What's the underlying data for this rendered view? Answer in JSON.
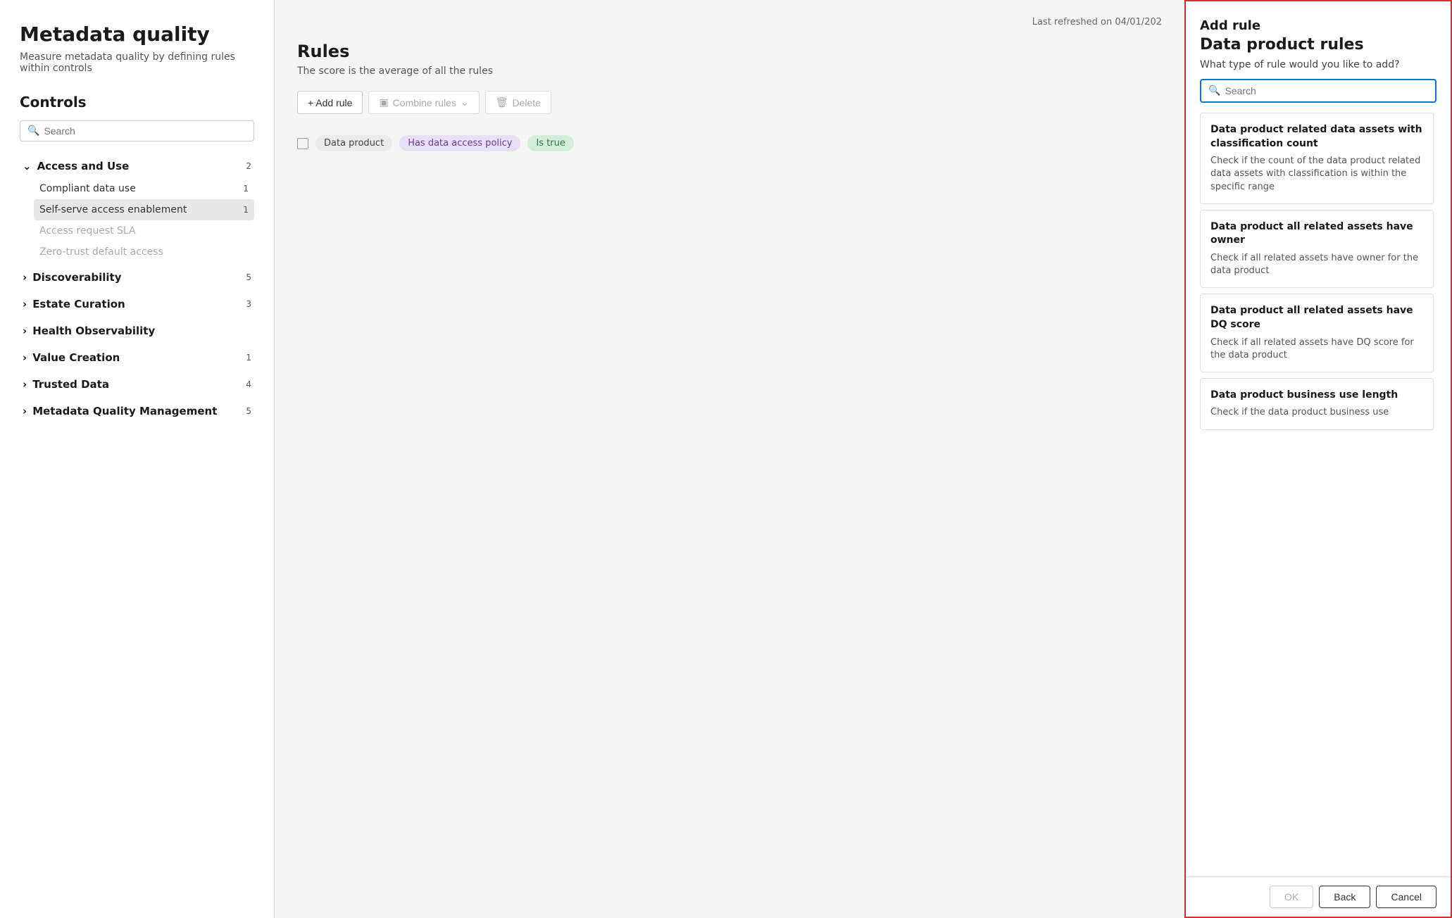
{
  "page": {
    "title": "Metadata quality",
    "subtitle": "Measure metadata quality by defining rules within controls",
    "last_refreshed": "Last refreshed on 04/01/202"
  },
  "controls": {
    "header": "Controls",
    "search_placeholder": "Search",
    "sections": [
      {
        "id": "access-and-use",
        "label": "Access and Use",
        "count": "2",
        "expanded": true,
        "children": [
          {
            "id": "compliant-data-use",
            "label": "Compliant data use",
            "count": "1",
            "active": false,
            "disabled": false
          },
          {
            "id": "self-serve-access",
            "label": "Self-serve access enablement",
            "count": "1",
            "active": true,
            "disabled": false
          },
          {
            "id": "access-request-sla",
            "label": "Access request SLA",
            "count": "",
            "active": false,
            "disabled": true
          },
          {
            "id": "zero-trust",
            "label": "Zero-trust default access",
            "count": "",
            "active": false,
            "disabled": true
          }
        ]
      },
      {
        "id": "discoverability",
        "label": "Discoverability",
        "count": "5",
        "expanded": false,
        "children": []
      },
      {
        "id": "estate-curation",
        "label": "Estate Curation",
        "count": "3",
        "expanded": false,
        "children": []
      },
      {
        "id": "health-observability",
        "label": "Health Observability",
        "count": "",
        "expanded": false,
        "children": []
      },
      {
        "id": "value-creation",
        "label": "Value Creation",
        "count": "1",
        "expanded": false,
        "children": []
      },
      {
        "id": "trusted-data",
        "label": "Trusted Data",
        "count": "4",
        "expanded": false,
        "children": []
      },
      {
        "id": "metadata-quality-mgmt",
        "label": "Metadata Quality Management",
        "count": "5",
        "expanded": false,
        "children": []
      }
    ]
  },
  "rules": {
    "header": "Rules",
    "subtitle": "The score is the average of all the rules",
    "toolbar": {
      "add_rule": "+ Add rule",
      "combine_rules": "Combine rules",
      "delete": "Delete"
    },
    "rows": [
      {
        "tag1": "Data product",
        "tag2": "Has data access policy",
        "tag3": "Is true"
      }
    ]
  },
  "add_rule_panel": {
    "title": "Add rule",
    "section_title": "Data product rules",
    "question": "What type of rule would you like to add?",
    "search_placeholder": "Search",
    "rule_cards": [
      {
        "id": "related-data-assets-classification",
        "title": "Data product related data assets with classification count",
        "description": "Check if the count of the data product related data assets with classification is within the specific range"
      },
      {
        "id": "all-related-assets-owner",
        "title": "Data product all related assets have owner",
        "description": "Check if all related assets have owner for the data product"
      },
      {
        "id": "all-related-assets-dq",
        "title": "Data product all related assets have DQ score",
        "description": "Check if all related assets have DQ score for the data product"
      },
      {
        "id": "business-use-length",
        "title": "Data product business use length",
        "description": "Check if the data product business use"
      }
    ],
    "footer": {
      "ok_label": "OK",
      "back_label": "Back",
      "cancel_label": "Cancel"
    }
  }
}
